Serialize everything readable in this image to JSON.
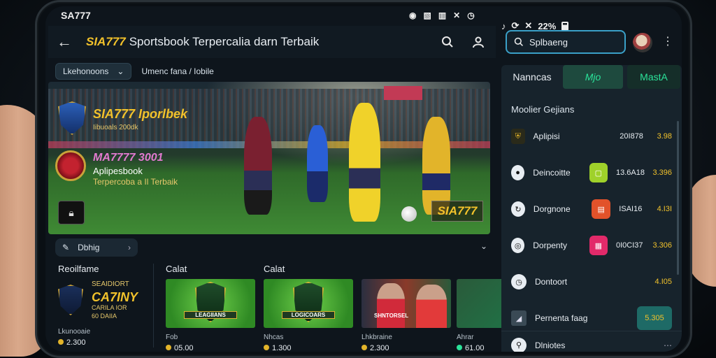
{
  "status_bar": {
    "carrier": "SA777",
    "battery_text": "22%"
  },
  "topbar": {
    "brand": "SIA777",
    "title": "Sportsbook Terpercalia darn Terbaik"
  },
  "subbar": {
    "chip_label": "Lkehonoons",
    "breadcrumb": "Umenc fana / Iobile"
  },
  "hero": {
    "brand": "SIA777 Iporlbek",
    "brand_sub": "Iibuoals 200dk",
    "line1": "MA7777 3001",
    "line2": "Aplipesbook",
    "line3": "Terpercoba a Il Terbaik",
    "stamp": "SIA777"
  },
  "filter": {
    "label": "Dbhig"
  },
  "games_section": {
    "left": {
      "header": "Reoilfame",
      "t1": "SEAIDIORT",
      "t2": "CA7INY",
      "t3": "CARILA IOR",
      "t4": "60 DAIIA",
      "foot": "Lkunooaie",
      "price": "2.300"
    },
    "cols": [
      {
        "header": "Calat",
        "tile_label": "LEAGIIANS",
        "foot": "Fob",
        "price": "05.00"
      },
      {
        "header": "Calat",
        "tile_label": "LOGICOARS",
        "foot": "Nhcas",
        "price": "1.300"
      },
      {
        "header": "",
        "tile_label": "SHNTORSEL",
        "foot": "Lhkbraine",
        "price": "2.300"
      },
      {
        "header": "",
        "tile_label": "",
        "foot": "Ahrar",
        "price": "61.00"
      }
    ]
  },
  "search": {
    "placeholder": "Splbaeng"
  },
  "panel": {
    "tabs": [
      "Nanncas",
      "Mjo",
      "MastA"
    ],
    "section_title": "Moolier Gejians",
    "rows": [
      {
        "name": "Aplipisi",
        "value": "20I878",
        "odd": "3.98",
        "badge": "",
        "badge_color": ""
      },
      {
        "name": "Deincoitte",
        "value": "13.6A18",
        "odd": "3.396",
        "badge": "▢",
        "badge_color": "#9fd12a"
      },
      {
        "name": "Dorgnone",
        "value": "ISAI16",
        "odd": "4.I3I",
        "badge": "▤",
        "badge_color": "#e2522a"
      },
      {
        "name": "Dorpenty",
        "value": "0I0CI37",
        "odd": "3.306",
        "badge": "▦",
        "badge_color": "#e22a6a"
      },
      {
        "name": "Dontoort",
        "value": "",
        "odd": "4.I05",
        "badge": "",
        "badge_color": ""
      },
      {
        "name": "Pernenta faag",
        "value": "",
        "odd": "5.305",
        "badge": "",
        "badge_color": ""
      }
    ],
    "footer": "Dlniotes"
  }
}
